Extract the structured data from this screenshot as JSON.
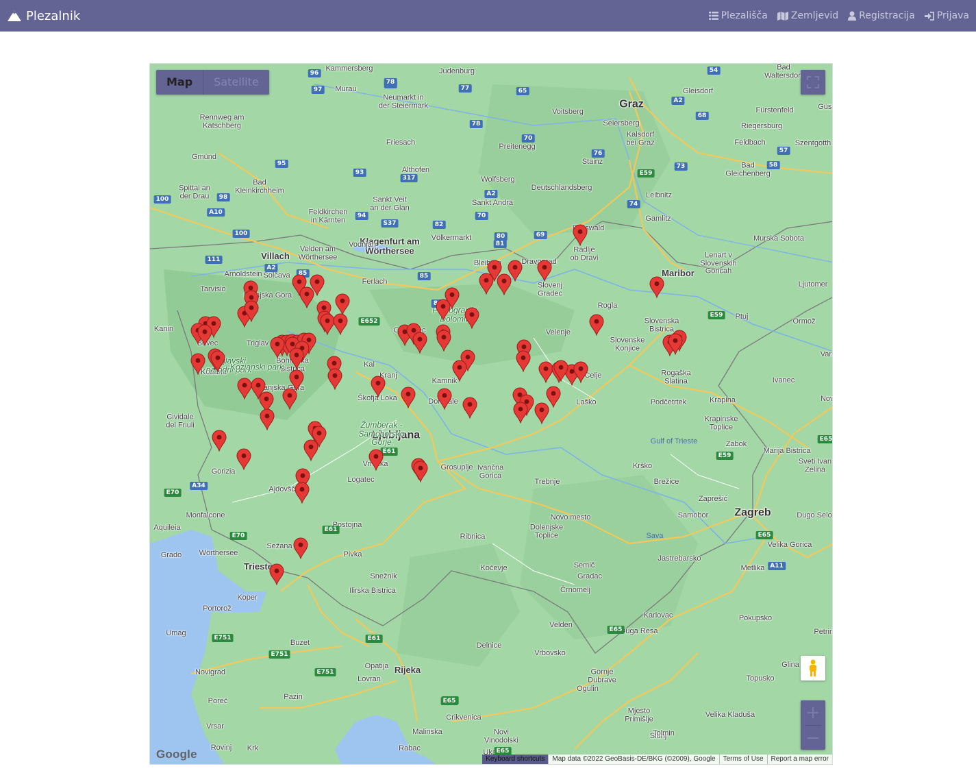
{
  "brand": {
    "name": "Plezalnik",
    "icon": "mountain-icon"
  },
  "nav": [
    {
      "label": "Plezališča",
      "icon": "list-icon"
    },
    {
      "label": "Zemljevid",
      "icon": "map-icon"
    },
    {
      "label": "Registracija",
      "icon": "user-icon"
    },
    {
      "label": "Prijava",
      "icon": "sign-in-icon"
    }
  ],
  "map": {
    "type_control": {
      "map": "Map",
      "satellite": "Satellite",
      "selected": "Map"
    },
    "logo": "Google",
    "attribution": {
      "shortcuts": "Keyboard shortcuts",
      "data": "Map data ©2022 GeoBasis-DE/BKG (©2009), Google",
      "terms": "Terms of Use",
      "report": "Report a map error"
    },
    "zoom": {
      "in": "+",
      "out": "−"
    },
    "colors": {
      "land": "#a3d7a6",
      "sea": "#9ec4f0",
      "marker": "#e53935",
      "navbar": "#636394"
    },
    "labels": [
      {
        "t": "Graz",
        "c": "big"
      },
      {
        "t": "Ljubljana",
        "c": "big"
      },
      {
        "t": "Zagreb",
        "c": "big"
      },
      {
        "t": "Maribor",
        "c": "med"
      },
      {
        "t": "Villach",
        "c": "med"
      },
      {
        "t": "Klagenfurt am\nWörthersee",
        "c": "med"
      },
      {
        "t": "Rijeka",
        "c": "med"
      },
      {
        "t": "Trieste",
        "c": "med"
      },
      {
        "t": "Celje",
        "c": "sm"
      },
      {
        "t": "Kranj",
        "c": "sm"
      },
      {
        "t": "Novo mesto",
        "c": "sm"
      },
      {
        "t": "Koper",
        "c": "sm"
      },
      {
        "t": "Kammersberg",
        "c": "sm"
      },
      {
        "t": "Judenburg",
        "c": "sm"
      },
      {
        "t": "Murau",
        "c": "sm"
      },
      {
        "t": "Neumarkt in\nder Steiermark",
        "c": "sm"
      },
      {
        "t": "Voitsberg",
        "c": "sm"
      },
      {
        "t": "Seiersberg",
        "c": "sm"
      },
      {
        "t": "Kalsdorf\nbei Graz",
        "c": "sm"
      },
      {
        "t": "Gleisdorf",
        "c": "sm"
      },
      {
        "t": "Bad\nWaltersdorf",
        "c": "sm"
      },
      {
        "t": "Fürstenfeld",
        "c": "sm"
      },
      {
        "t": "Riegersburg",
        "c": "sm"
      },
      {
        "t": "Feldbach",
        "c": "sm"
      },
      {
        "t": "Szentgotth",
        "c": "sm"
      },
      {
        "t": "Güss",
        "c": "sm"
      },
      {
        "t": "Rennweg am\nKatschberg",
        "c": "sm"
      },
      {
        "t": "Friesach",
        "c": "sm"
      },
      {
        "t": "Preitenegg",
        "c": "sm"
      },
      {
        "t": "Gmünd",
        "c": "sm"
      },
      {
        "t": "Althofen",
        "c": "sm"
      },
      {
        "t": "Wolfsberg",
        "c": "sm"
      },
      {
        "t": "Stainz",
        "c": "sm"
      },
      {
        "t": "Bad\nGleichenberg",
        "c": "sm"
      },
      {
        "t": "Bad\nKleinkirchheim",
        "c": "sm"
      },
      {
        "t": "Spittal an\nder Drau",
        "c": "sm"
      },
      {
        "t": "Sankt Veit\nan der Glan",
        "c": "sm"
      },
      {
        "t": "Sankt Andrä",
        "c": "sm"
      },
      {
        "t": "Deutschlandsberg",
        "c": "sm"
      },
      {
        "t": "Leibnitz",
        "c": "sm"
      },
      {
        "t": "Feldkirchen\nin Kärnten",
        "c": "sm"
      },
      {
        "t": "Gamlitz",
        "c": "sm"
      },
      {
        "t": "Eibiswald",
        "c": "sm"
      },
      {
        "t": "Murska Sobota",
        "c": "sm"
      },
      {
        "t": "Völkermarkt",
        "c": "sm"
      },
      {
        "t": "Velden am\nWörthersee",
        "c": "sm"
      },
      {
        "t": "Radlje\nob Dravi",
        "c": "sm"
      },
      {
        "t": "Lenart v\nSlovenskih\nGoricah",
        "c": "sm"
      },
      {
        "t": "Arnoldstein",
        "c": "sm"
      },
      {
        "t": "Bleiburg",
        "c": "sm"
      },
      {
        "t": "Dravograd",
        "c": "sm"
      },
      {
        "t": "Ferlach",
        "c": "sm"
      },
      {
        "t": "Tarvisio",
        "c": "sm"
      },
      {
        "t": "Slovenj\nGradec",
        "c": "sm"
      },
      {
        "t": "Ljutomer",
        "c": "sm"
      },
      {
        "t": "Kranjska Gora",
        "c": "sm"
      },
      {
        "t": "Rogla",
        "c": "sm"
      },
      {
        "t": "Ptuj",
        "c": "sm"
      },
      {
        "t": "Ormož",
        "c": "sm"
      },
      {
        "t": "Kanin",
        "c": "sm"
      },
      {
        "t": "Slovenska\nBistrica",
        "c": "sm"
      },
      {
        "t": "Grintovec",
        "c": "sm"
      },
      {
        "t": "Velenje",
        "c": "sm"
      },
      {
        "t": "Bovec",
        "c": "sm"
      },
      {
        "t": "Slovenske\nKonjice",
        "c": "sm"
      },
      {
        "t": "Triglav",
        "c": "sm"
      },
      {
        "t": "Vara",
        "c": "sm"
      },
      {
        "t": "Bohinjska\nBistrica",
        "c": "sm"
      },
      {
        "t": "Rogaška\nSlatina",
        "c": "sm"
      },
      {
        "t": "Kobarid",
        "c": "sm"
      },
      {
        "t": "Kamnik",
        "c": "sm"
      },
      {
        "t": "Ivanec",
        "c": "sm"
      },
      {
        "t": "Škofja Loka",
        "c": "sm"
      },
      {
        "t": "Domžale",
        "c": "sm"
      },
      {
        "t": "Laško",
        "c": "sm"
      },
      {
        "t": "Podčetrtek",
        "c": "sm"
      },
      {
        "t": "Krapina",
        "c": "sm"
      },
      {
        "t": "Novi",
        "c": "sm"
      },
      {
        "t": "Cividale\ndel Friuli",
        "c": "sm"
      },
      {
        "t": "Krapinske\nToplice",
        "c": "sm"
      },
      {
        "t": "Zabok",
        "c": "sm"
      },
      {
        "t": "Marija Bistrica",
        "c": "sm"
      },
      {
        "t": "Sveti Ivan\nZelina",
        "c": "sm"
      },
      {
        "t": "Gorizia",
        "c": "sm"
      },
      {
        "t": "Vrhnika",
        "c": "sm"
      },
      {
        "t": "Grosuplje",
        "c": "sm"
      },
      {
        "t": "Ivančna\nGorica",
        "c": "sm"
      },
      {
        "t": "Krško",
        "c": "sm"
      },
      {
        "t": "Brežice",
        "c": "sm"
      },
      {
        "t": "Trebnje",
        "c": "sm"
      },
      {
        "t": "Logatec",
        "c": "sm"
      },
      {
        "t": "Ajdovščina",
        "c": "sm"
      },
      {
        "t": "Zaprešić",
        "c": "sm"
      },
      {
        "t": "Monfalcone",
        "c": "sm"
      },
      {
        "t": "Samobor",
        "c": "sm"
      },
      {
        "t": "Dugo Selo",
        "c": "sm"
      },
      {
        "t": "Aquileia",
        "c": "sm"
      },
      {
        "t": "Postojna",
        "c": "sm"
      },
      {
        "t": "Ribnica",
        "c": "sm"
      },
      {
        "t": "Dolenjske\nToplice",
        "c": "sm"
      },
      {
        "t": "Velika Gorica",
        "c": "sm"
      },
      {
        "t": "Grado",
        "c": "sm"
      },
      {
        "t": "Sežana",
        "c": "sm"
      },
      {
        "t": "Pivka",
        "c": "sm"
      },
      {
        "t": "Jastrebarsko",
        "c": "sm"
      },
      {
        "t": "Kočevje",
        "c": "sm"
      },
      {
        "t": "Semič",
        "c": "sm"
      },
      {
        "t": "Metlika",
        "c": "sm"
      },
      {
        "t": "Gradac",
        "c": "sm"
      },
      {
        "t": "Snežnik",
        "c": "sm"
      },
      {
        "t": "Ilirska Bistrica",
        "c": "sm"
      },
      {
        "t": "Črnomelj",
        "c": "sm"
      },
      {
        "t": "Portorož",
        "c": "sm"
      },
      {
        "t": "Karlovac",
        "c": "sm"
      },
      {
        "t": "Pokupsko",
        "c": "sm"
      },
      {
        "t": "Umag",
        "c": "sm"
      },
      {
        "t": "Duga Resa",
        "c": "sm"
      },
      {
        "t": "Petrinja",
        "c": "sm"
      },
      {
        "t": "Buzet",
        "c": "sm"
      },
      {
        "t": "Delnice",
        "c": "sm"
      },
      {
        "t": "Vrbovsko",
        "c": "sm"
      },
      {
        "t": "Glina",
        "c": "sm"
      },
      {
        "t": "Opatija",
        "c": "sm"
      },
      {
        "t": "Novigrad",
        "c": "sm"
      },
      {
        "t": "Lovran",
        "c": "sm"
      },
      {
        "t": "Gornje\nDubrave",
        "c": "sm"
      },
      {
        "t": "Topusko",
        "c": "sm"
      },
      {
        "t": "Ogulin",
        "c": "sm"
      },
      {
        "t": "Poreč",
        "c": "sm"
      },
      {
        "t": "Pazin",
        "c": "sm"
      },
      {
        "t": "Mjesto\nPrimišlje",
        "c": "sm"
      },
      {
        "t": "Velika Kladuša",
        "c": "sm"
      },
      {
        "t": "Crikvenica",
        "c": "sm"
      },
      {
        "t": "Vrsar",
        "c": "sm"
      },
      {
        "t": "Malinska",
        "c": "sm"
      },
      {
        "t": "Novi\nVinodolski",
        "c": "sm"
      },
      {
        "t": "Slunj",
        "c": "sm"
      },
      {
        "t": "Rovinj",
        "c": "sm"
      },
      {
        "t": "Rabac",
        "c": "sm"
      },
      {
        "t": "Ukanc",
        "c": "sm"
      },
      {
        "t": "Tolmin",
        "c": "sm"
      },
      {
        "t": "Solčava",
        "c": "sm"
      },
      {
        "t": "Triglavski\nnarodni park",
        "c": "park"
      },
      {
        "t": "Polhograjski\nDolomiti",
        "c": "park"
      },
      {
        "t": "Kozjanski park",
        "c": "park"
      },
      {
        "t": "Žumberak -\nSamoborsko\nGorje",
        "c": "park"
      },
      {
        "t": "Gulf of Trieste",
        "c": "sea"
      },
      {
        "t": "Sava",
        "c": "sea"
      },
      {
        "t": "Wörthersee",
        "c": "sm"
      },
      {
        "t": "Kal",
        "c": "sm"
      },
      {
        "t": "Vodnjan",
        "c": "sm"
      },
      {
        "t": "Kranjska Gora",
        "c": "sm"
      },
      {
        "t": "Velden",
        "c": "sm"
      },
      {
        "t": "Krk",
        "c": "sm"
      }
    ],
    "shields": [
      "96",
      "96",
      "97",
      "78",
      "77",
      "65",
      "54",
      "A2",
      "68",
      "76",
      "57",
      "73",
      "58",
      "95",
      "93",
      "317",
      "78",
      "70",
      "A2",
      "E59",
      "100",
      "98",
      "A10",
      "94",
      "S37",
      "82",
      "70",
      "74",
      "100",
      "111",
      "A2",
      "85",
      "85",
      "80",
      "81",
      "69",
      "82",
      "E652",
      "E59",
      "E61",
      "E65",
      "E65",
      "E59",
      "A34",
      "E70",
      "E70",
      "E61",
      "E65",
      "A11",
      "E751",
      "E61",
      "E751",
      "E65",
      "E65",
      "E751",
      "E65"
    ],
    "marker_count": 86
  }
}
